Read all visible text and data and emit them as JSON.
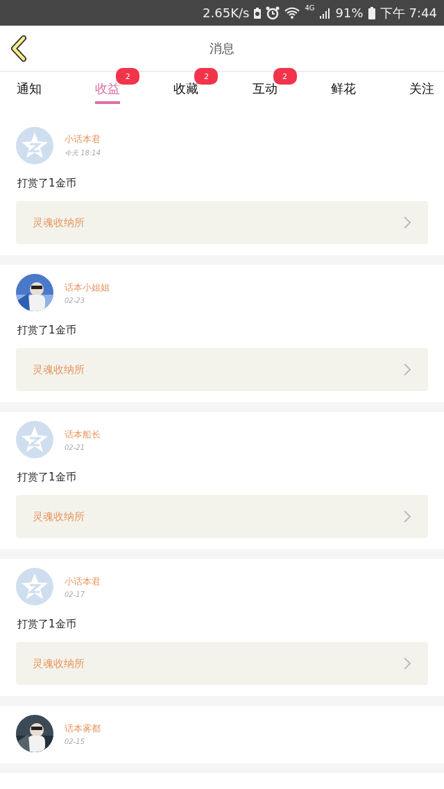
{
  "status_bar": {
    "speed": "2.65K/s",
    "network": "4G",
    "battery": "91%",
    "period": "下午",
    "time": "7:44"
  },
  "header": {
    "title": "消息"
  },
  "tabs": [
    {
      "label": "通知",
      "selected": false
    },
    {
      "label": "收益",
      "selected": true,
      "badge": "2"
    },
    {
      "label": "收藏",
      "selected": false,
      "badge": "2"
    },
    {
      "label": "互动",
      "selected": false,
      "badge": "2"
    },
    {
      "label": "鲜花",
      "selected": false
    },
    {
      "label": "关注",
      "selected": false
    }
  ],
  "messages": [
    {
      "avatar": {
        "kind": "default"
      },
      "name": "小话本君",
      "time": "今天 18:14",
      "text": "打赏了1金币",
      "link": "灵魂收纳所"
    },
    {
      "name": "话本小姐姐",
      "time": "02-23",
      "text": "打赏了1金币",
      "link": "灵魂收纳所"
    },
    {
      "avatar": {
        "kind": "default"
      },
      "name": "话本船长",
      "time": "02-21",
      "text": "打赏了1金币",
      "link": "灵魂收纳所"
    },
    {
      "avatar": {
        "kind": "default"
      },
      "name": "小话本君",
      "time": "02-17",
      "text": "打赏了1金币",
      "link": "灵魂收纳所"
    },
    {
      "name": "话本雾都",
      "time": "02-15"
    }
  ]
}
